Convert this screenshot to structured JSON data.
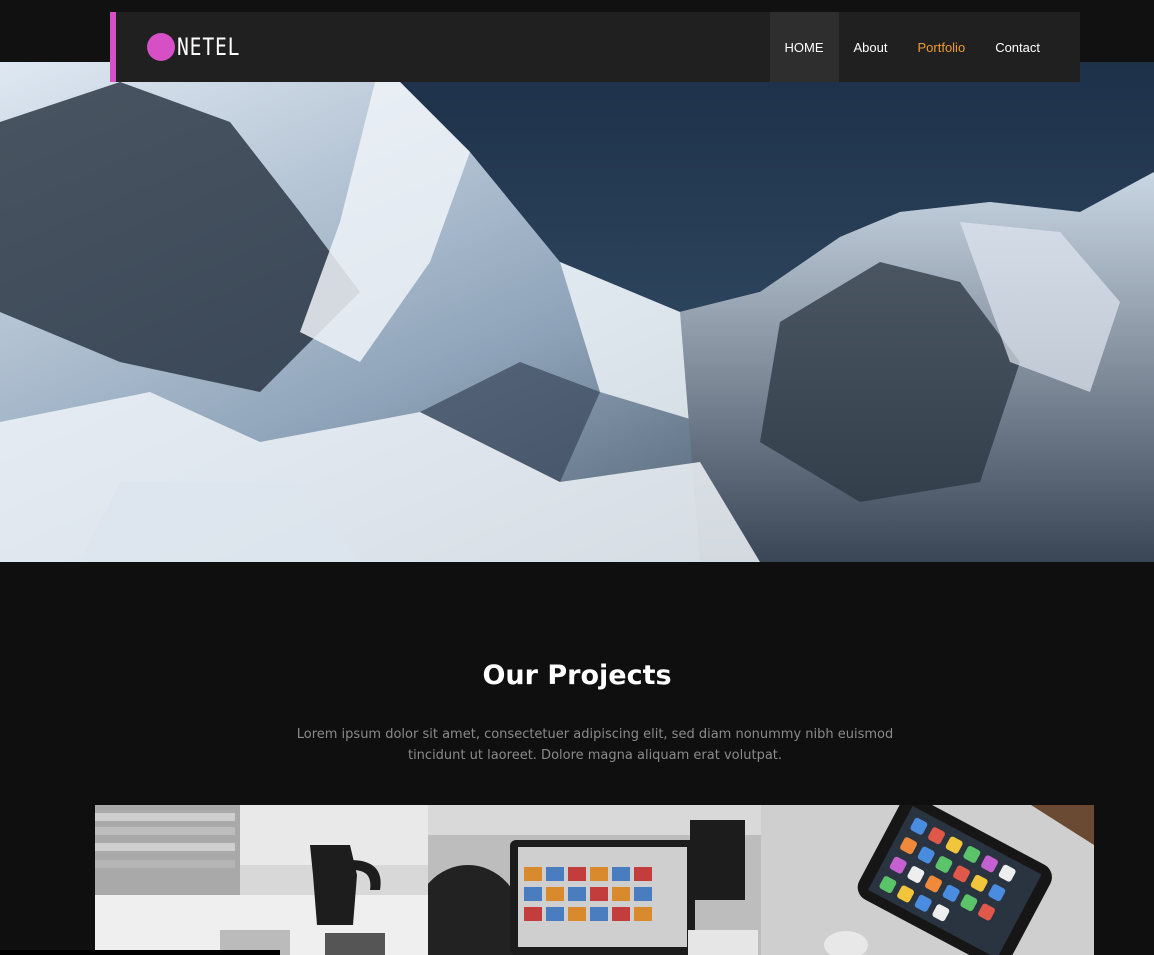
{
  "brand": {
    "logo_text": "NETEL",
    "accent_color": "#d64fc4"
  },
  "nav": {
    "items": [
      {
        "label": "HOME",
        "state": "active"
      },
      {
        "label": "About"
      },
      {
        "label": "Portfolio",
        "color": "#ee9b30"
      },
      {
        "label": "Contact"
      }
    ]
  },
  "hero": {
    "image": "snowy-mountain-range"
  },
  "projects": {
    "title": "Our Projects",
    "description": "Lorem ipsum dolor sit amet, consectetuer adipiscing elit, sed diam nonummy nibh euismod tincidunt ut laoreet. Dolore magna aliquam erat volutpat.",
    "thumbnails": [
      {
        "image": "desk-with-coffee-pot-and-magazines"
      },
      {
        "image": "person-using-laptop-with-photo-gallery"
      },
      {
        "image": "smartphone-on-laptop"
      }
    ]
  }
}
